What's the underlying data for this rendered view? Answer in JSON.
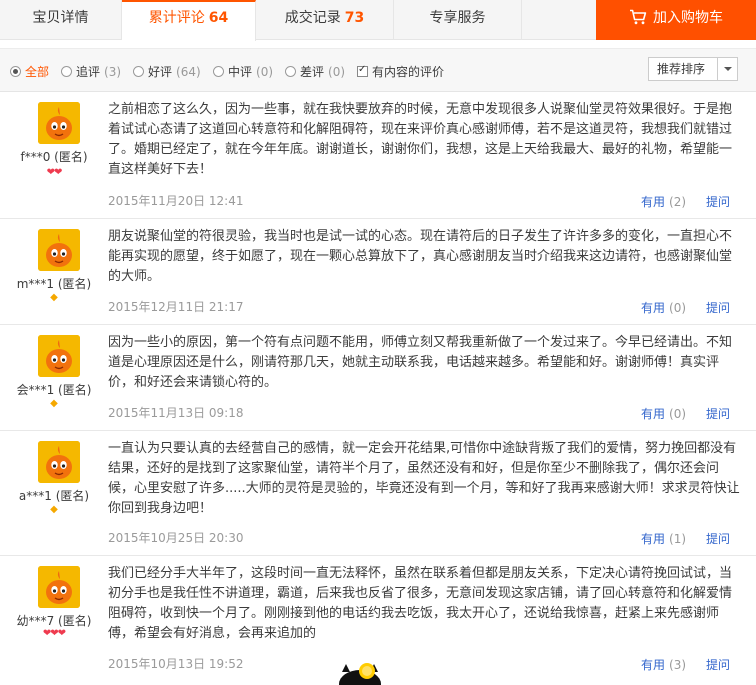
{
  "tabs": [
    {
      "label": "宝贝详情",
      "count": ""
    },
    {
      "label": "累计评论",
      "count": "64"
    },
    {
      "label": "成交记录",
      "count": "73"
    },
    {
      "label": "专享服务",
      "count": ""
    }
  ],
  "cart_button": {
    "label": "加入购物车",
    "icon": "shopping-cart-icon"
  },
  "filters": [
    {
      "label": "全部",
      "count": ""
    },
    {
      "label": "追评",
      "count": "(3)"
    },
    {
      "label": "好评",
      "count": "(64)"
    },
    {
      "label": "中评",
      "count": "(0)"
    },
    {
      "label": "差评",
      "count": "(0)"
    }
  ],
  "content_filter": {
    "label": "有内容的评价",
    "checked": true
  },
  "sort": {
    "selected": "推荐排序"
  },
  "useful_label": "有用",
  "ask_label": "提问",
  "reviews": [
    {
      "user": "f***0 (匿名)",
      "rank": "hearts",
      "text": "之前相恋了这么久，因为一些事，就在我快要放弃的时候，无意中发现很多人说聚仙堂灵符效果很好。于是抱着试试心态请了这道回心转意符和化解阻碍符，现在来评价真心感谢师傅，若不是这道灵符，我想我们就错过了。婚期已经定了，就在今年年底。谢谢道长，谢谢你们，我想，这是上天给我最大、最好的礼物，希望能一直这样美好下去！",
      "date": "2015年11月20日 12:41",
      "useful": "(2)"
    },
    {
      "user": "m***1 (匿名)",
      "rank": "diamond",
      "text": "朋友说聚仙堂的符很灵验，我当时也是试一试的心态。现在请符后的日子发生了许许多多的变化，一直担心不能再实现的愿望，终于如愿了，现在一颗心总算放下了，真心感谢朋友当时介绍我来这边请符，也感谢聚仙堂的大师。",
      "date": "2015年12月11日 21:17",
      "useful": "(0)"
    },
    {
      "user": "会***1 (匿名)",
      "rank": "diamond",
      "text": "因为一些小的原因，第一个符有点问题不能用，师傅立刻又帮我重新做了一个发过来了。今早已经请出。不知道是心理原因还是什么，刚请符那几天，她就主动联系我，电话越来越多。希望能和好。谢谢师傅！真实评价，和好还会来请锁心符的。",
      "date": "2015年11月13日 09:18",
      "useful": "(0)"
    },
    {
      "user": "a***1 (匿名)",
      "rank": "diamond",
      "text": "一直认为只要认真的去经营自己的感情，就一定会开花结果,可惜你中途缺背叛了我们的爱情，努力挽回都没有结果，还好的是找到了这家聚仙堂，请符半个月了，虽然还没有和好，但是你至少不删除我了，偶尔还会问候，心里安慰了许多.....大师的灵符是灵验的，毕竟还没有到一个月，等和好了我再来感谢大师！求求灵符快让你回到我身边吧！",
      "date": "2015年10月25日 20:30",
      "useful": "(1)"
    },
    {
      "user": "幼***7 (匿名)",
      "rank": "hearts3",
      "text": "我们已经分手大半年了，这段时间一直无法释怀，虽然在联系着但都是朋友关系，下定决心请符挽回试试，当初分手也是我任性不讲道理，霸道，后来我也反省了很多，无意间发现这家店铺，请了回心转意符和化解爱情阻碍符，收到快一个月了。刚刚接到他的电话约我去吃饭，我太开心了，还说给我惊喜，赶紧上来先感谢师傅，希望会有好消息，会再来追加的",
      "date": "2015年10月13日 19:52",
      "useful": "(3)"
    }
  ]
}
